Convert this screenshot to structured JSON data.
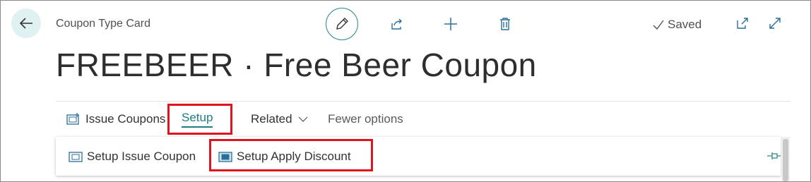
{
  "header": {
    "caption": "Coupon Type Card",
    "title": "FREEBEER · Free Beer Coupon",
    "status": "Saved"
  },
  "icons": {
    "back": "arrow-left-icon",
    "edit": "pencil-icon",
    "share": "share-icon",
    "new": "plus-icon",
    "delete": "trash-icon",
    "saved": "checkmark-icon",
    "open_new": "open-in-new-window-icon",
    "expand": "expand-icon",
    "pin": "pin-icon"
  },
  "actionbar": {
    "issue_coupons": "Issue Coupons",
    "setup": "Setup",
    "related": "Related",
    "fewer_options": "Fewer options"
  },
  "setup_menu": {
    "items": [
      "Setup Issue Coupon",
      "Setup Apply Discount"
    ]
  },
  "colors": {
    "accent": "#1d7d82",
    "highlight": "#e0141e"
  }
}
